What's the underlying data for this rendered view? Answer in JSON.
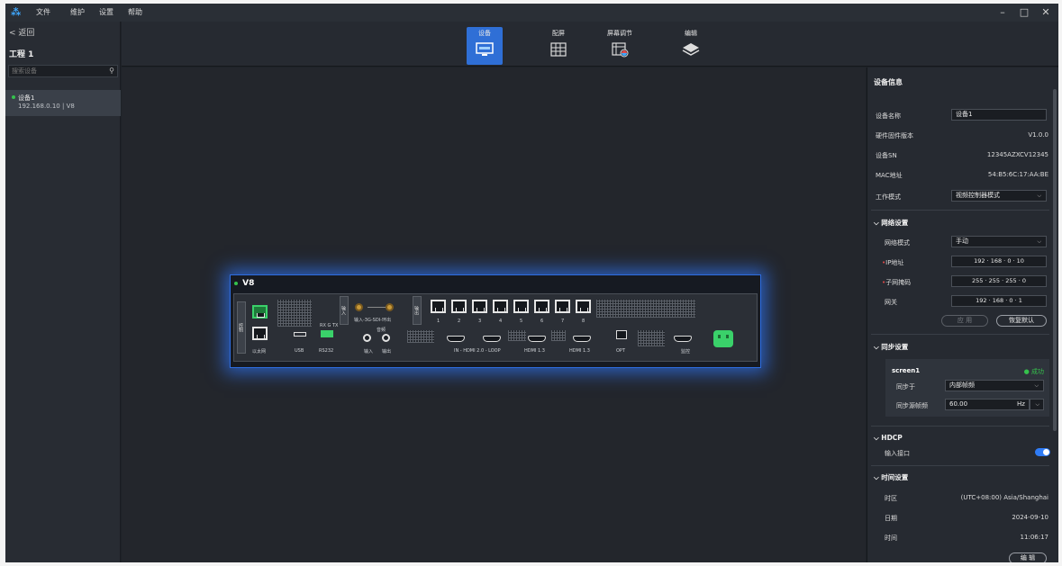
{
  "menu": [
    "文件",
    "维护",
    "设置",
    "帮助"
  ],
  "window_controls": {
    "minimize": "–",
    "maximize": "□",
    "close": "✕"
  },
  "left": {
    "back_label": "< 返回",
    "project": "工程 1",
    "search_placeholder": "搜索设备",
    "devices": [
      {
        "name": "设备1",
        "sub": "192.168.0.10 | V8",
        "status": "online"
      }
    ]
  },
  "toolbar": {
    "tabs": [
      {
        "label": "设备",
        "icon": "monitor-icon",
        "active": true
      },
      {
        "label": "配屏",
        "icon": "screen-grid-icon",
        "active": false
      },
      {
        "label": "屏幕调节",
        "icon": "screen-adjust-icon",
        "active": false
      },
      {
        "label": "编辑",
        "icon": "layers-icon",
        "active": false
      }
    ]
  },
  "device": {
    "title": "V8",
    "labels": {
      "control": "控制",
      "ethernet": "以太网",
      "usb": "USB",
      "rs232": "RS232",
      "rs232_pins": "RX G TX",
      "input": "输入",
      "sdi": "输入-3G-SDI-环出",
      "audio": "音频",
      "audio_in": "输入",
      "audio_out": "输出",
      "output": "输出",
      "ports": [
        "1",
        "2",
        "3",
        "4",
        "5",
        "6",
        "7",
        "8"
      ],
      "hdmi_in_loop": "IN - HDMI 2.0 - LOOP",
      "hdmi13a": "HDMI 1.3",
      "hdmi13b": "HDMI 1.3",
      "opt": "OPT",
      "monitor": "监控"
    }
  },
  "panel": {
    "title": "设备信息",
    "device_name_label": "设备名称",
    "device_name": "设备1",
    "firmware_label": "硬件固件版本",
    "firmware": "V1.0.0",
    "sn_label": "设备SN",
    "sn": "12345AZXCV12345",
    "mac_label": "MAC地址",
    "mac": "54:B5:6C:17:AA:BE",
    "mode_label": "工作模式",
    "mode": "视频控制器模式",
    "network": {
      "title": "网络设置",
      "mode_label": "网络模式",
      "mode": "手动",
      "ip_label": "IP地址",
      "ip": [
        "192",
        "168",
        "0",
        "10"
      ],
      "mask_label": "子网掩码",
      "mask": [
        "255",
        "255",
        "255",
        "0"
      ],
      "gw_label": "网关",
      "gw": [
        "192",
        "168",
        "0",
        "1"
      ],
      "apply": "应 用",
      "reset": "恢复默认"
    },
    "sync": {
      "title": "同步设置",
      "screen": "screen1",
      "status": "● 成功",
      "sync_label": "同步于",
      "sync_value": "内部帧频",
      "freq_label": "同步源帧频",
      "freq": "60.00",
      "unit": "Hz"
    },
    "hdcp": {
      "title": "HDCP",
      "input_label": "输入接口",
      "enabled": true
    },
    "time": {
      "title": "时间设置",
      "tz_label": "时区",
      "tz": "(UTC+08:00) Asia/Shanghai",
      "date_label": "日期",
      "date": "2024-09-10",
      "time_label": "时间",
      "time": "11:06:17",
      "edit": "编 辑"
    }
  },
  "colors": {
    "accent": "#2f6fd6",
    "online": "#35c24c",
    "glow": "#2e6de0"
  }
}
